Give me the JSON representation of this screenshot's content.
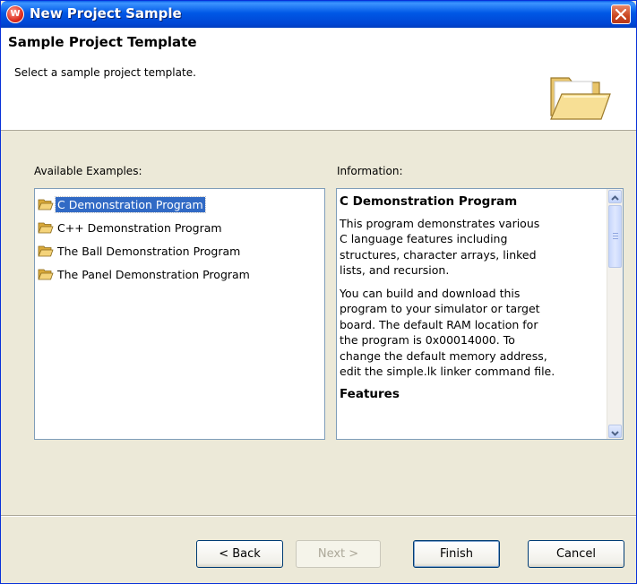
{
  "window": {
    "title": "New Project Sample",
    "app_icon_letter": "W"
  },
  "header": {
    "title": "Sample Project Template",
    "description": "Select a sample project template.",
    "icon": "open-folder-icon"
  },
  "examples": {
    "label": "Available Examples:",
    "items": [
      "C Demonstration Program",
      "C++ Demonstration Program",
      "The Ball Demonstration Program",
      "The Panel Demonstration Program"
    ],
    "selected_index": 0
  },
  "information": {
    "label": "Information:",
    "heading": "C Demonstration Program",
    "paragraph1": "This program demonstrates various\nC language features including\nstructures, character arrays, linked\nlists, and recursion.",
    "paragraph2": "You can build and download this\nprogram to your simulator or target\nboard. The default RAM location for\nthe program is 0x00014000. To\nchange the default memory address,\nedit the simple.lk linker command file.",
    "subheading": "Features"
  },
  "buttons": {
    "back": "< Back",
    "next": "Next >",
    "finish": "Finish",
    "cancel": "Cancel"
  },
  "colors": {
    "titlebar": "#0058e6",
    "selection": "#316ac5",
    "dialog_bg": "#ece9d8"
  }
}
